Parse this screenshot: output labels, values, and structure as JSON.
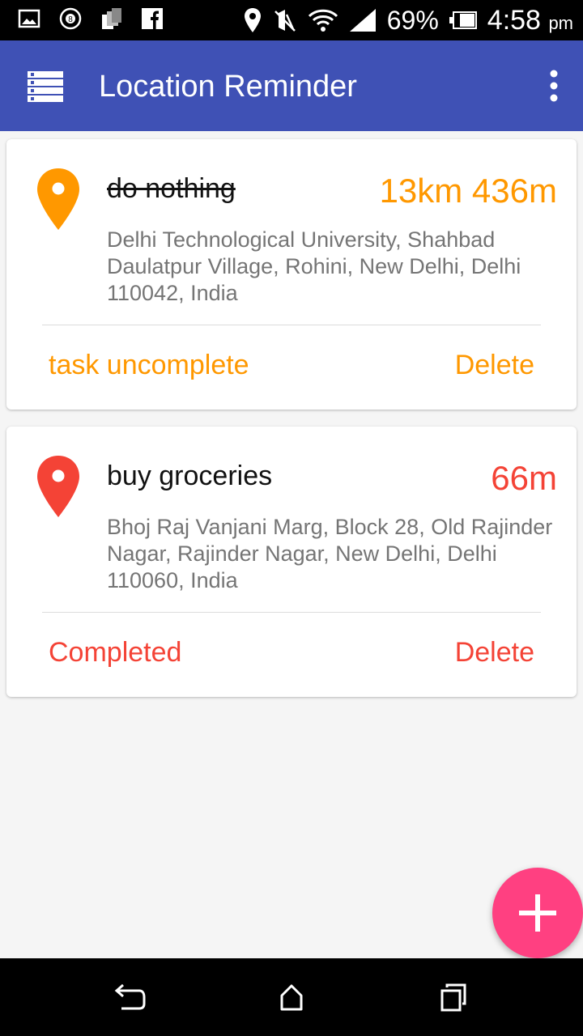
{
  "status_bar": {
    "battery": "69%",
    "time": "4:58",
    "time_suffix": "pm",
    "icons": [
      "image-icon",
      "eight-ball-icon",
      "stack-icon",
      "facebook-icon",
      "location-icon",
      "mute-icon",
      "wifi-icon",
      "signal-icon",
      "battery-icon"
    ]
  },
  "app_bar": {
    "title": "Location Reminder",
    "menu_icon": "list-menu-icon",
    "overflow_icon": "more-vert-icon",
    "color": "#3f51b5"
  },
  "reminders": [
    {
      "title": "do nothing",
      "completed": true,
      "distance": "13km 436m",
      "address": "Delhi Technological University, Shahbad Daulatpur Village, Rohini, New Delhi, Delhi 110042, India",
      "toggle_label": "task uncomplete",
      "delete_label": "Delete",
      "accent": "#ff9800"
    },
    {
      "title": "buy groceries",
      "completed": false,
      "distance": "66m",
      "address": "Bhoj Raj Vanjani Marg, Block 28, Old Rajinder Nagar, Rajinder Nagar, New Delhi, Delhi 110060, India",
      "toggle_label": "Completed",
      "delete_label": "Delete",
      "accent": "#f44336"
    }
  ],
  "fab": {
    "icon": "add-icon",
    "color": "#ff4081"
  },
  "nav_bar": {
    "icons": [
      "back-icon",
      "home-icon",
      "recents-icon"
    ]
  }
}
